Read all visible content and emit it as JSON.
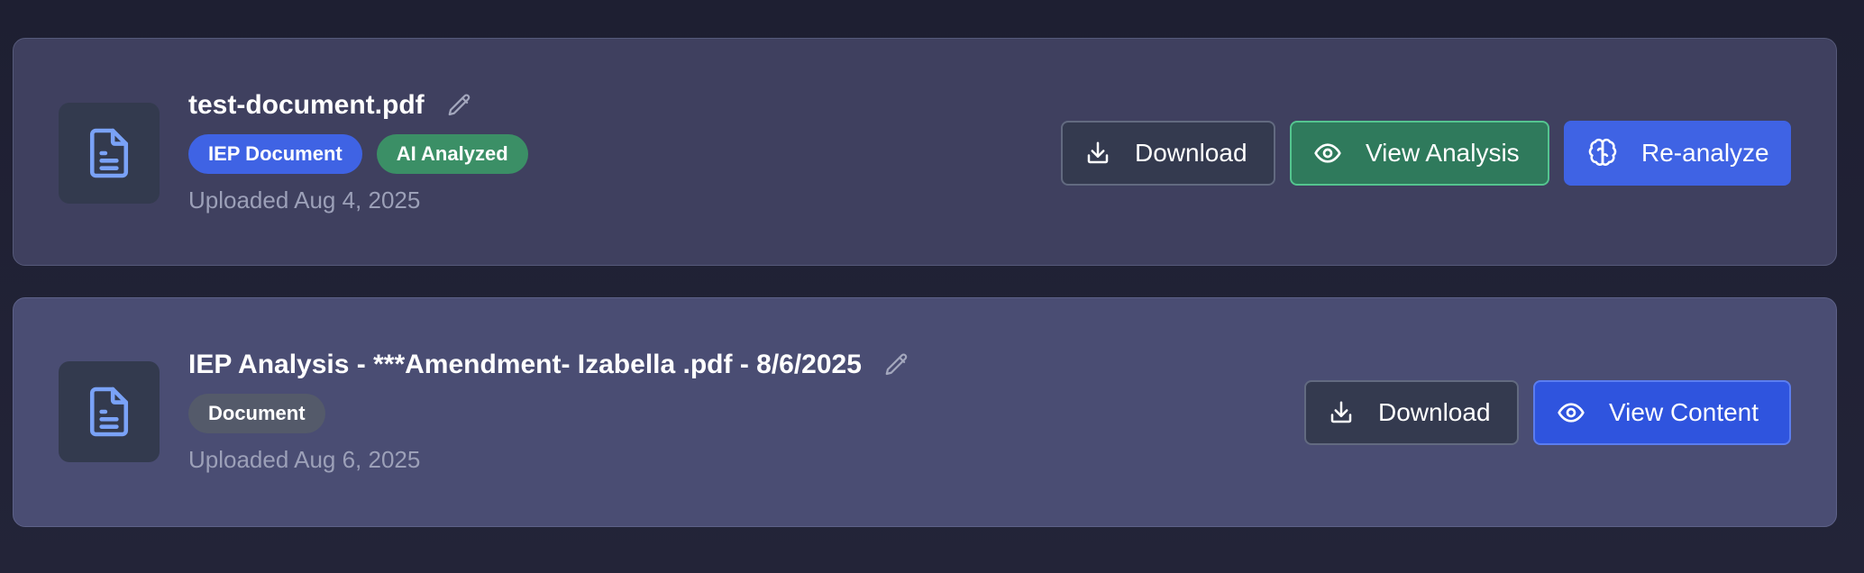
{
  "colors": {
    "background": "#1e1f32",
    "card_1_bg": "#3f405f",
    "card_2_bg": "#4a4d73",
    "badge_iep": "#3f63e4",
    "badge_ai": "#3b8f66",
    "badge_document": "#545a6a",
    "file_icon": "#7aa2f7"
  },
  "documents": [
    {
      "title": "test-document.pdf",
      "icon": "document-icon",
      "badges": [
        {
          "label": "IEP Document",
          "color": "#3f63e4"
        },
        {
          "label": "AI Analyzed",
          "color": "#3b8f66"
        }
      ],
      "uploaded": "Uploaded Aug 4, 2025",
      "actions": [
        {
          "label": "Download",
          "icon": "download-icon"
        },
        {
          "label": "View Analysis",
          "icon": "eye-icon"
        },
        {
          "label": "Re-analyze",
          "icon": "brain-icon"
        }
      ]
    },
    {
      "title": "IEP Analysis - ***Amendment- Izabella .pdf - 8/6/2025",
      "icon": "document-icon",
      "badges": [
        {
          "label": "Document",
          "color": "#545a6a"
        }
      ],
      "uploaded": "Uploaded Aug 6, 2025",
      "actions": [
        {
          "label": "Download",
          "icon": "download-icon"
        },
        {
          "label": "View Content",
          "icon": "eye-icon"
        }
      ]
    }
  ]
}
